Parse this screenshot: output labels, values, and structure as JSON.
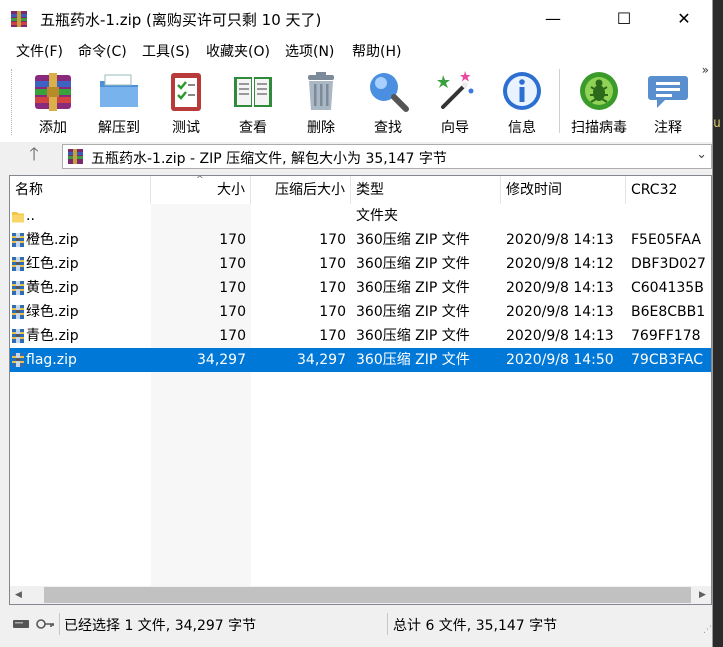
{
  "window": {
    "title": "五瓶药水-1.zip (离购买许可只剩 10 天了)",
    "minimize": "—",
    "maximize": "☐",
    "close": "✕"
  },
  "menu": [
    "文件(F)",
    "命令(C)",
    "工具(S)",
    "收藏夹(O)",
    "选项(N)",
    "帮助(H)"
  ],
  "toolbar": {
    "more": "»",
    "buttons": [
      {
        "label": "添加",
        "icon": "add-books-icon"
      },
      {
        "label": "解压到",
        "icon": "extract-folder-icon"
      },
      {
        "label": "测试",
        "icon": "test-clipboard-icon"
      },
      {
        "label": "查看",
        "icon": "view-book-icon"
      },
      {
        "label": "删除",
        "icon": "trash-icon"
      },
      {
        "label": "查找",
        "icon": "magnifier-icon"
      },
      {
        "label": "向导",
        "icon": "wizard-wand-icon"
      },
      {
        "label": "信息",
        "icon": "info-icon"
      },
      {
        "label": "扫描病毒",
        "icon": "virus-scan-icon"
      },
      {
        "label": "注释",
        "icon": "comment-icon"
      }
    ]
  },
  "address": {
    "up": "🡑",
    "path": "五瓶药水-1.zip - ZIP 压缩文件, 解包大小为 35,147 字节",
    "dropdown": "⌄"
  },
  "list": {
    "sort_arrow": "^",
    "columns": [
      "名称",
      "大小",
      "压缩后大小",
      "类型",
      "修改时间",
      "CRC32"
    ],
    "rows": [
      {
        "name": "..",
        "size": "",
        "packed": "",
        "type": "文件夹",
        "modified": "",
        "crc": "",
        "icon": "folder-icon",
        "selected": false
      },
      {
        "name": "橙色.zip",
        "size": "170",
        "packed": "170",
        "type": "360压缩 ZIP 文件",
        "modified": "2020/9/8 14:13",
        "crc": "F5E05FAA",
        "icon": "zip-file-icon",
        "selected": false
      },
      {
        "name": "红色.zip",
        "size": "170",
        "packed": "170",
        "type": "360压缩 ZIP 文件",
        "modified": "2020/9/8 14:12",
        "crc": "DBF3D027",
        "icon": "zip-file-icon",
        "selected": false
      },
      {
        "name": "黄色.zip",
        "size": "170",
        "packed": "170",
        "type": "360压缩 ZIP 文件",
        "modified": "2020/9/8 14:13",
        "crc": "C604135B",
        "icon": "zip-file-icon",
        "selected": false
      },
      {
        "name": "绿色.zip",
        "size": "170",
        "packed": "170",
        "type": "360压缩 ZIP 文件",
        "modified": "2020/9/8 14:13",
        "crc": "B6E8CBB1",
        "icon": "zip-file-icon",
        "selected": false
      },
      {
        "name": "青色.zip",
        "size": "170",
        "packed": "170",
        "type": "360压缩 ZIP 文件",
        "modified": "2020/9/8 14:13",
        "crc": "769FF178",
        "icon": "zip-file-icon",
        "selected": false
      },
      {
        "name": "flag.zip",
        "size": "34,297",
        "packed": "34,297",
        "type": "360压缩 ZIP 文件",
        "modified": "2020/9/8 14:50",
        "crc": "79CB3FAC",
        "icon": "zip-file-icon",
        "selected": true
      }
    ]
  },
  "scrollbar": {
    "left": "◀",
    "right": "▶"
  },
  "status": {
    "left": "已经选择 1 文件, 34,297 字节",
    "right": "总计 6 文件, 35,147 字节",
    "grip": "⋰"
  },
  "desktop": {
    "fragment": "u"
  },
  "colors": {
    "selection": "#0078d7",
    "accent": "#0078d7"
  }
}
